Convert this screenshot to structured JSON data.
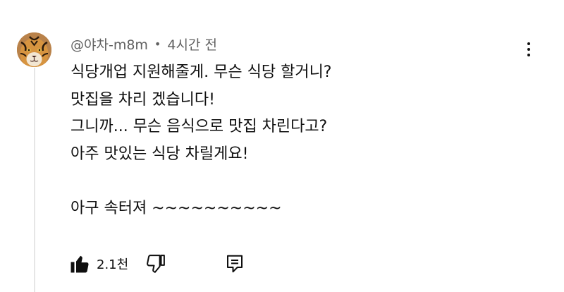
{
  "comment": {
    "author": "@야차-m8m",
    "separator": "•",
    "timestamp": "4시간 전",
    "lines": [
      "식당개업 지원해줄게. 무슨 식당 할거니?",
      "맛집을 차리 겠습니다!",
      "그니까... 무슨 음식으로 맛집 차린다고?",
      "아주 맛있는 식당 차릴게요!",
      "",
      "아구 속터져 ~~~~~~~~~~"
    ]
  },
  "actions": {
    "like_count": "2.1천"
  },
  "icons": {
    "avatar": "tiger-avatar",
    "more": "more-vertical-icon",
    "like": "thumbs-up-icon",
    "dislike": "thumbs-down-icon",
    "reply": "reply-comment-icon"
  },
  "colors": {
    "text": "#0f0f0f",
    "meta_text": "#606060",
    "thread_line": "#e6e6e6"
  }
}
